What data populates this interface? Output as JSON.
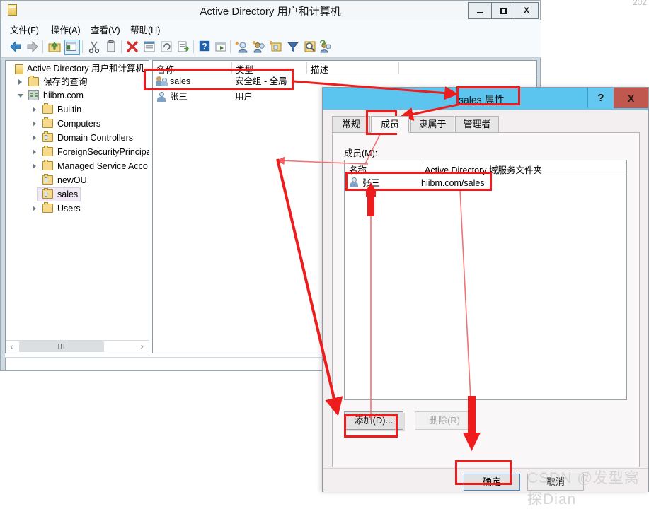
{
  "main_window": {
    "title": "Active Directory 用户和计算机",
    "window_buttons": {
      "minimize": "–",
      "maximize": "□",
      "close": "X"
    },
    "menu": [
      {
        "label": "文件(F)"
      },
      {
        "label": "操作(A)"
      },
      {
        "label": "查看(V)"
      },
      {
        "label": "帮助(H)"
      }
    ],
    "toolbar_icons": [
      "back-icon",
      "forward-icon",
      "up-folder-icon",
      "show-hide-tree-icon",
      "cut-icon",
      "copy-icon",
      "delete-icon",
      "properties-icon",
      "refresh-icon",
      "export-list-icon",
      "help-icon",
      "console-icon",
      "new-user-icon",
      "new-group-icon",
      "new-ou-icon",
      "filter-icon",
      "find-icon",
      "add-members-icon"
    ],
    "tree": {
      "root": "Active Directory 用户和计算机",
      "items": [
        {
          "label": "保存的查询",
          "icon": "folder-icon",
          "expandable": true,
          "indent": 0
        },
        {
          "label": "hiibm.com",
          "icon": "domain-icon",
          "expandable": true,
          "expanded": true,
          "indent": 0
        },
        {
          "label": "Builtin",
          "icon": "folder-icon",
          "expandable": true,
          "indent": 1
        },
        {
          "label": "Computers",
          "icon": "folder-icon",
          "expandable": true,
          "indent": 1
        },
        {
          "label": "Domain Controllers",
          "icon": "ou-folder-icon",
          "expandable": true,
          "indent": 1
        },
        {
          "label": "ForeignSecurityPrincipa",
          "icon": "folder-icon",
          "expandable": true,
          "indent": 1
        },
        {
          "label": "Managed Service Acco",
          "icon": "folder-icon",
          "expandable": true,
          "indent": 1
        },
        {
          "label": "newOU",
          "icon": "ou-folder-icon",
          "expandable": false,
          "indent": 1
        },
        {
          "label": "sales",
          "icon": "ou-folder-icon",
          "expandable": false,
          "indent": 1,
          "selected": true
        },
        {
          "label": "Users",
          "icon": "folder-icon",
          "expandable": true,
          "indent": 1
        }
      ],
      "hscroll": {
        "left_arrow": "‹",
        "right_arrow": "›",
        "thumb_grip": "III"
      }
    },
    "list": {
      "columns": [
        "名称",
        "类型",
        "描述"
      ],
      "rows": [
        {
          "name": "sales",
          "type": "安全组 - 全局",
          "description": "",
          "icon": "group-icon"
        },
        {
          "name": "张三",
          "type": "用户",
          "description": "",
          "icon": "user-icon"
        }
      ]
    }
  },
  "dialog": {
    "title": "sales 属性",
    "help_button": "?",
    "close_button": "X",
    "tabs": [
      {
        "label": "常规",
        "active": false
      },
      {
        "label": "成员",
        "active": true
      },
      {
        "label": "隶属于",
        "active": false
      },
      {
        "label": "管理者",
        "active": false
      }
    ],
    "members_label": "成员(M):",
    "members_columns": [
      "名称",
      "Active Directory 域服务文件夹"
    ],
    "members_rows": [
      {
        "name": "张三",
        "folder": "hiibm.com/sales",
        "icon": "user-icon"
      }
    ],
    "add_button": "添加(D)...",
    "remove_button": "删除(R)",
    "ok_button": "确定",
    "cancel_button": "取消"
  },
  "annotations": {
    "highlight_color": "#ee1c1c",
    "highlighted": [
      "list-row-sales",
      "dialog-title",
      "tab-members",
      "member-row-zhangsan",
      "add-button",
      "ok-button"
    ]
  },
  "watermark": {
    "text": "CSDN @发型窝探Dian"
  },
  "corner_text": "202"
}
